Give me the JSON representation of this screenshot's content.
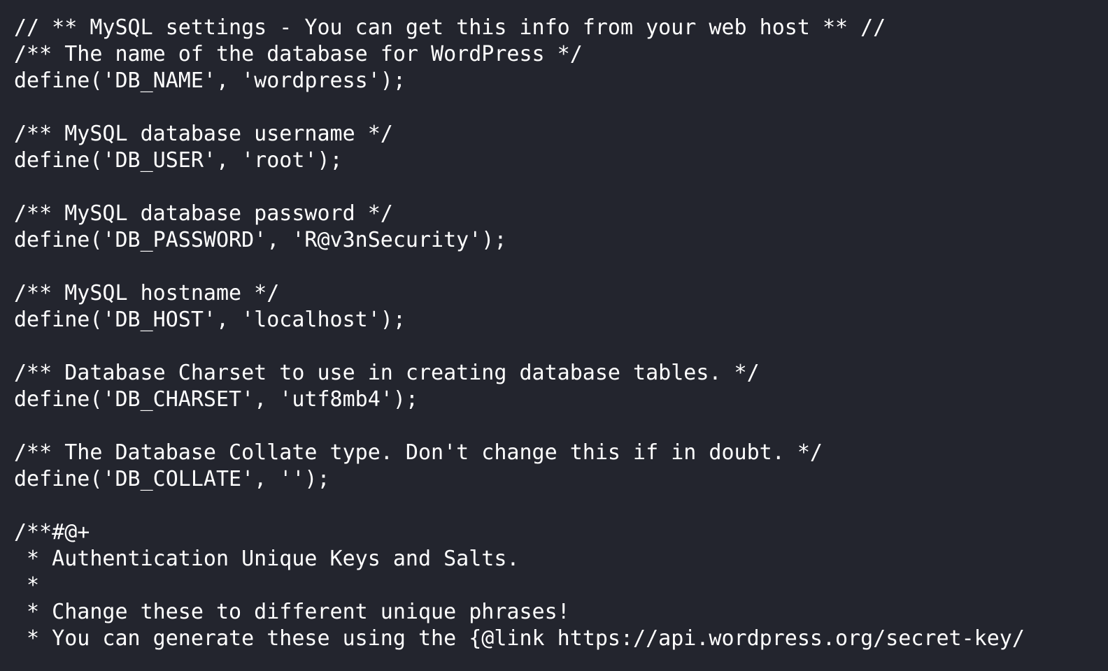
{
  "terminal": {
    "lines": [
      "// ** MySQL settings - You can get this info from your web host ** //",
      "/** The name of the database for WordPress */",
      "define('DB_NAME', 'wordpress');",
      "",
      "/** MySQL database username */",
      "define('DB_USER', 'root');",
      "",
      "/** MySQL database password */",
      "define('DB_PASSWORD', 'R@v3nSecurity');",
      "",
      "/** MySQL hostname */",
      "define('DB_HOST', 'localhost');",
      "",
      "/** Database Charset to use in creating database tables. */",
      "define('DB_CHARSET', 'utf8mb4');",
      "",
      "/** The Database Collate type. Don't change this if in doubt. */",
      "define('DB_COLLATE', '');",
      "",
      "/**#@+",
      " * Authentication Unique Keys and Salts.",
      " *",
      " * Change these to different unique phrases!",
      " * You can generate these using the {@link https://api.wordpress.org/secret-key/"
    ]
  }
}
